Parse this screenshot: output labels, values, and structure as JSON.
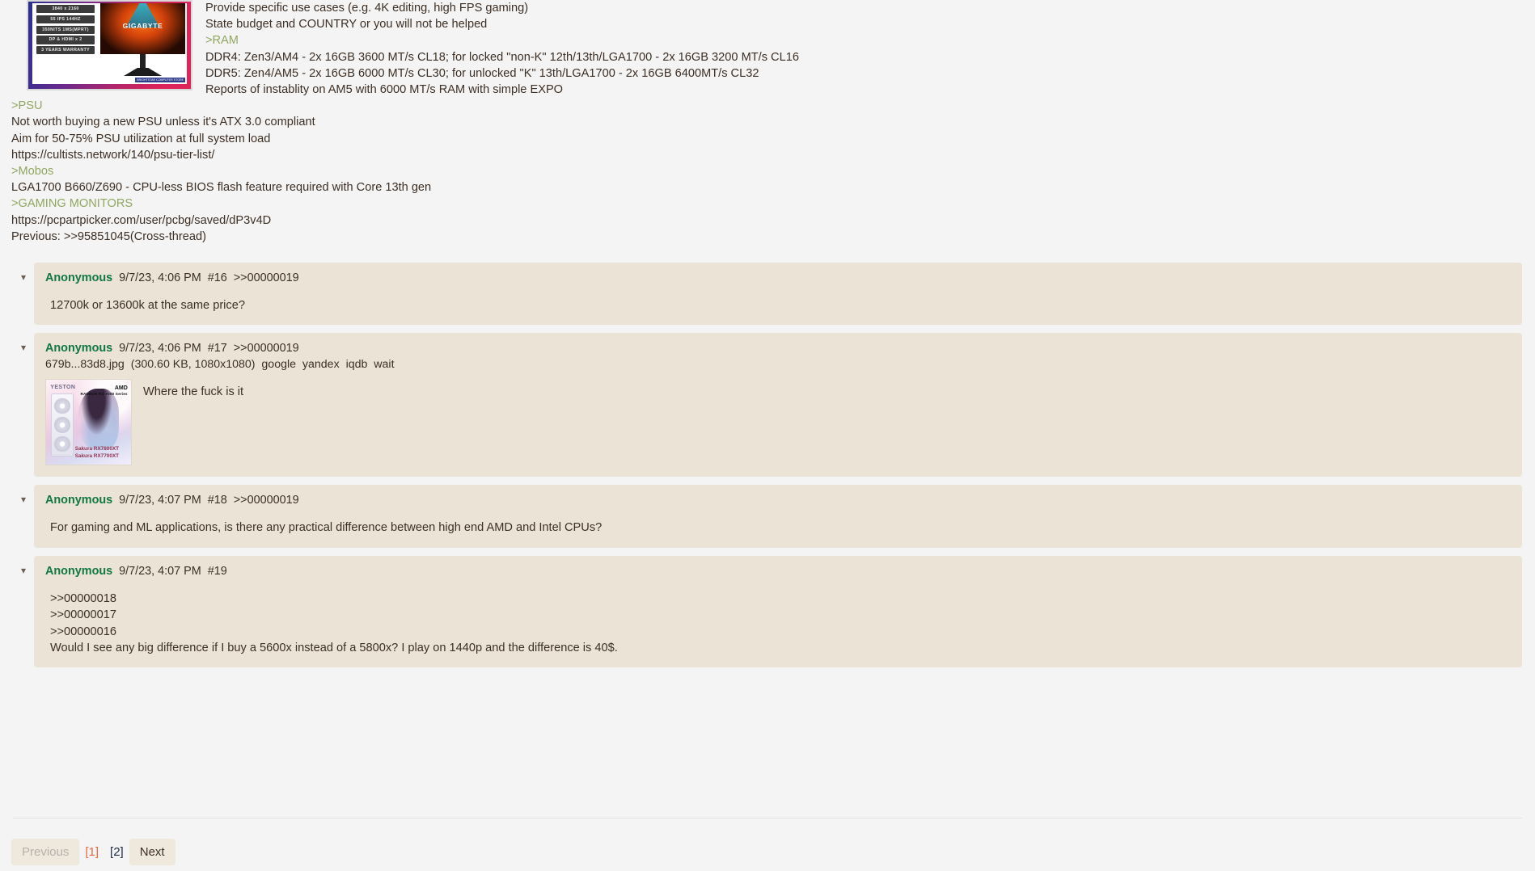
{
  "theme": {
    "page_bg": "#f4f4f4",
    "post_bg": "#ebe4d6",
    "text": "#3d2f24",
    "name_green": "#117743",
    "greentext": "#91a661",
    "current_page": "#e8693a",
    "page_link": "#1b2b45"
  },
  "op": {
    "thumbnail": {
      "alt": "gigabyte-monitor-ad-thumbnail",
      "brand": "GIGABYTE",
      "specs": [
        "3840 x 2160",
        "55 IPS\n144HZ",
        "350NITS\n1MS(MPRT)",
        "DP & HDMI x 2",
        "3 YEARS\nWARRANTY"
      ],
      "store_badge": "BRIGHTSTAR\nCOMPUTER STORE"
    },
    "lines": [
      {
        "text": "Provide specific use cases (e.g. 4K editing, high FPS gaming)",
        "green": false,
        "indent": true
      },
      {
        "text": "State budget and COUNTRY or you will not be helped",
        "green": false,
        "indent": true
      },
      {
        "text": ">RAM",
        "green": true,
        "indent": true
      },
      {
        "text": "DDR4: Zen3/AM4 - 2x 16GB 3600 MT/s CL18; for locked \"non-K\" 12th/13th/LGA1700 - 2x 16GB 3200 MT/s CL16",
        "green": false,
        "indent": true
      },
      {
        "text": "DDR5: Zen4/AM5 - 2x 16GB 6000 MT/s CL30; for unlocked \"K\" 13th/LGA1700 - 2x 16GB 6400MT/s CL32",
        "green": false,
        "indent": true
      },
      {
        "text": "Reports of instablity on AM5 with 6000 MT/s RAM with simple EXPO",
        "green": false,
        "indent": true
      },
      {
        "text": ">PSU",
        "green": true,
        "indent": true
      },
      {
        "text": "Not worth buying a new PSU unless it's ATX 3.0 compliant",
        "green": false,
        "indent": false
      },
      {
        "text": "Aim for 50-75% PSU utilization at full system load",
        "green": false,
        "indent": false
      },
      {
        "text": "https://cultists.network/140/psu-tier-list/",
        "green": false,
        "indent": false
      },
      {
        "text": ">Mobos",
        "green": true,
        "indent": false
      },
      {
        "text": "LGA1700 B660/Z690 - CPU-less BIOS flash feature required with Core 13th gen",
        "green": false,
        "indent": false
      },
      {
        "text": ">GAMING MONITORS",
        "green": true,
        "indent": false
      },
      {
        "text": "https://pcpartpicker.com/user/pcbg/saved/dP3v4D",
        "green": false,
        "indent": false
      },
      {
        "text": "Previous: >>95851045(Cross-thread)",
        "green": false,
        "indent": false
      }
    ]
  },
  "posts": [
    {
      "collapse_icon": "chevron-down-icon",
      "name": "Anonymous",
      "date": "9/7/23, 4:06 PM",
      "no": "#16",
      "backlink": ">>00000019",
      "file": null,
      "body": "12700k or 13600k at the same price?"
    },
    {
      "collapse_icon": "chevron-down-icon",
      "name": "Anonymous",
      "date": "9/7/23, 4:06 PM",
      "no": "#17",
      "backlink": ">>00000019",
      "file": {
        "filename": "679b...83d8.jpg",
        "meta": "(300.60 KB, 1080x1080)",
        "search_links": [
          "google",
          "yandex",
          "iqdb",
          "wait"
        ],
        "thumb": {
          "alt": "yeston-sakura-radeon-gpu-thumbnail",
          "brand": "YESTON",
          "amd_top": "AMD",
          "amd_sub": "RADEON\nRX 7000 Series",
          "model_line1": "Sakura RX7800XT",
          "model_line2": "Sakura RX7700XT"
        }
      },
      "body": "Where the fuck is it"
    },
    {
      "collapse_icon": "chevron-down-icon",
      "name": "Anonymous",
      "date": "9/7/23, 4:07 PM",
      "no": "#18",
      "backlink": ">>00000019",
      "file": null,
      "body": "For gaming and ML applications, is there any practical difference between high end AMD and Intel CPUs?"
    },
    {
      "collapse_icon": "chevron-down-icon",
      "name": "Anonymous",
      "date": "9/7/23, 4:07 PM",
      "no": "#19",
      "backlink": "",
      "file": null,
      "body": ">>00000018\n>>00000017\n>>00000016\nWould I see any big difference if I buy a 5600x instead of a 5800x? I play on 1440p and the difference is 40$."
    }
  ],
  "pagination": {
    "previous_label": "Previous",
    "next_label": "Next",
    "pages": [
      {
        "label": "[1]",
        "current": true
      },
      {
        "label": "[2]",
        "current": false
      }
    ]
  }
}
